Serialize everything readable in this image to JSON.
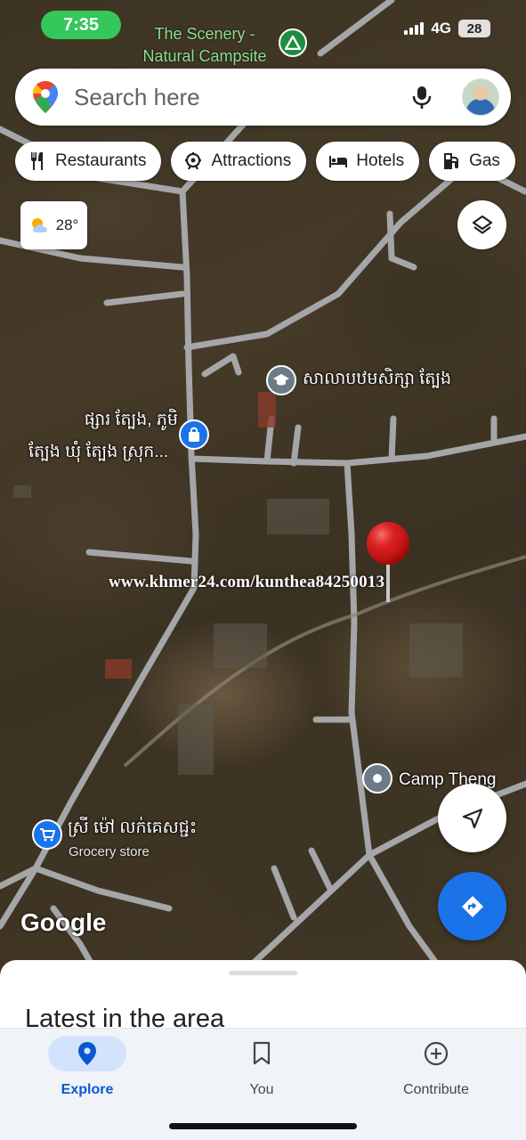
{
  "status_bar": {
    "time": "7:35",
    "network": "4G",
    "battery": "28"
  },
  "map": {
    "top_place": {
      "label_line1": "The Scenery -",
      "label_line2": "Natural Campsite",
      "icon": "campsite-icon"
    },
    "school": {
      "label": "សាលាបឋមសិក្សា ត្បែង",
      "icon": "school-icon"
    },
    "market": {
      "label_line1": "ផ្សារ ត្បែង, ភូមិ",
      "label_line2": "ត្បែង ឃុំ ត្បែង ស្រុក...",
      "icon": "shopping-bag-icon"
    },
    "camp": {
      "label": "Camp Theng",
      "icon": "location-pin-icon"
    },
    "grocery": {
      "label": "ស្រី ម៉ៅ លក់គេសជ្ជះ",
      "sublabel": "Grocery store",
      "icon": "shopping-cart-icon"
    },
    "watermark": "www.khmer24.com/kunthea84250013",
    "logo": "Google",
    "weather": {
      "temp": "28°",
      "icon": "partly-cloudy-icon"
    }
  },
  "search": {
    "placeholder": "Search here"
  },
  "chips": [
    {
      "label": "Restaurants",
      "icon": "fork-knife-icon"
    },
    {
      "label": "Attractions",
      "icon": "attractions-icon"
    },
    {
      "label": "Hotels",
      "icon": "bed-icon"
    },
    {
      "label": "Gas",
      "icon": "gas-pump-icon"
    }
  ],
  "sheet": {
    "title": "Latest in the area"
  },
  "nav": [
    {
      "label": "Explore",
      "active": true
    },
    {
      "label": "You",
      "active": false
    },
    {
      "label": "Contribute",
      "active": false
    }
  ],
  "colors": {
    "accent": "#1a73e8",
    "nav_active": "#0b57d0",
    "status_pill": "#34c759",
    "camp_green": "#1e8e3e"
  }
}
